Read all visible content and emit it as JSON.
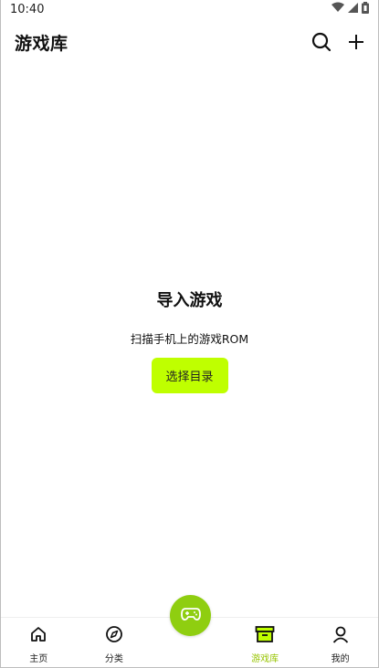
{
  "status_bar": {
    "time": "10:40",
    "icons": [
      "wifi-icon",
      "signal-icon",
      "battery-icon"
    ]
  },
  "app_bar": {
    "title": "游戏库",
    "actions": [
      "search-icon",
      "add-icon"
    ]
  },
  "empty_state": {
    "title": "导入游戏",
    "description": "扫描手机上的游戏ROM",
    "button_label": "选择目录"
  },
  "bottom_nav": {
    "items": [
      {
        "label": "主页",
        "icon": "home-icon",
        "active": false
      },
      {
        "label": "分类",
        "icon": "compass-icon",
        "active": false
      },
      {
        "label": "游戏库",
        "icon": "archive-icon",
        "active": true
      },
      {
        "label": "我的",
        "icon": "person-icon",
        "active": false
      }
    ],
    "fab_icon": "gamepad-icon"
  },
  "colors": {
    "accent": "#bfff00",
    "fab": "#8fce10",
    "active_label": "#97c400"
  }
}
